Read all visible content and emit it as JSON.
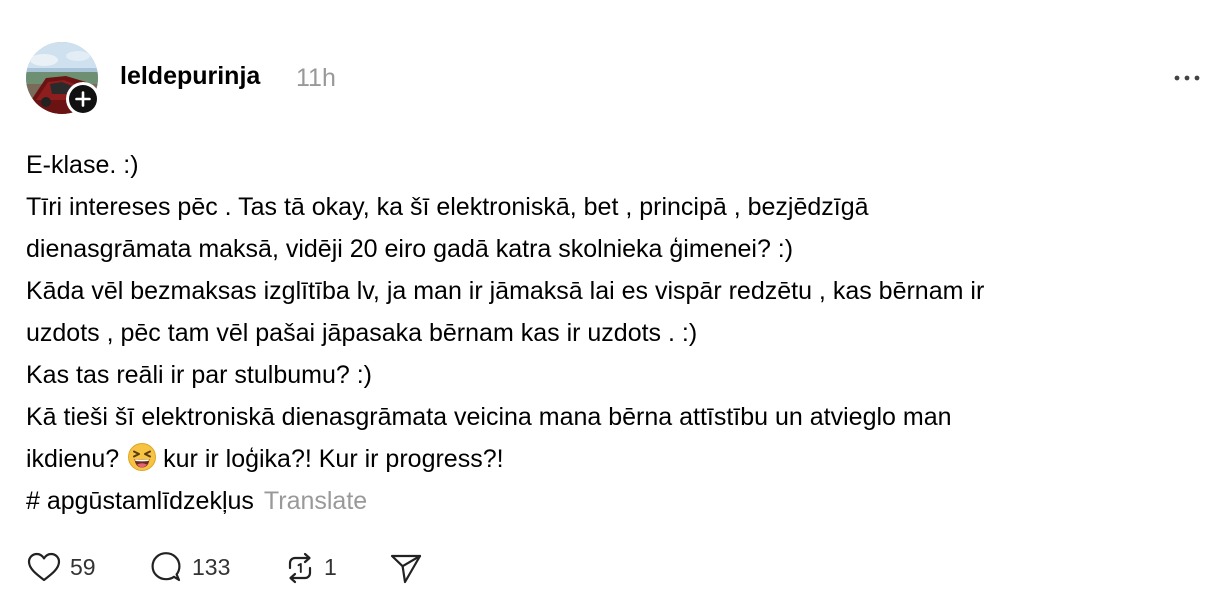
{
  "post": {
    "username": "leldepurinja",
    "timestamp": "11h",
    "lines": [
      "E-klase. :)",
      "Tīri intereses pēc . Tas tā okay, ka šī elektroniskā, bet , principā , bezjēdzīgā",
      "dienasgrāmata maksā, vidēji 20 eiro gadā katra skolnieka ģimenei? :)",
      "Kāda vēl bezmaksas izglītība lv, ja man ir jāmaksā lai es vispār redzētu , kas bērnam ir",
      "uzdots , pēc tam vēl pašai jāpasaka bērnam kas ir uzdots . :)",
      "Kas tas reāli ir par stulbumu? :)",
      "Kā tieši šī elektroniskā dienasgrāmata veicina mana bērna attīstību un atvieglo man"
    ],
    "last_line_before_emoji": "ikdienu?",
    "last_line_after_emoji": "kur ir loģika?! Kur ir progress?!",
    "emoji": "laughing-squinting-face",
    "hashtag": "# apgūstamlīdzekļus",
    "translate_label": "Translate"
  },
  "actions": {
    "likes": "59",
    "comments": "133",
    "reposts": "1"
  },
  "icons": {
    "follow": "plus-icon",
    "more": "ellipsis-icon",
    "like": "heart-icon",
    "comment": "comment-bubble-icon",
    "repost": "repost-icon",
    "share": "send-icon"
  },
  "colors": {
    "text": "#000000",
    "muted": "#999999",
    "counts": "#333333"
  }
}
